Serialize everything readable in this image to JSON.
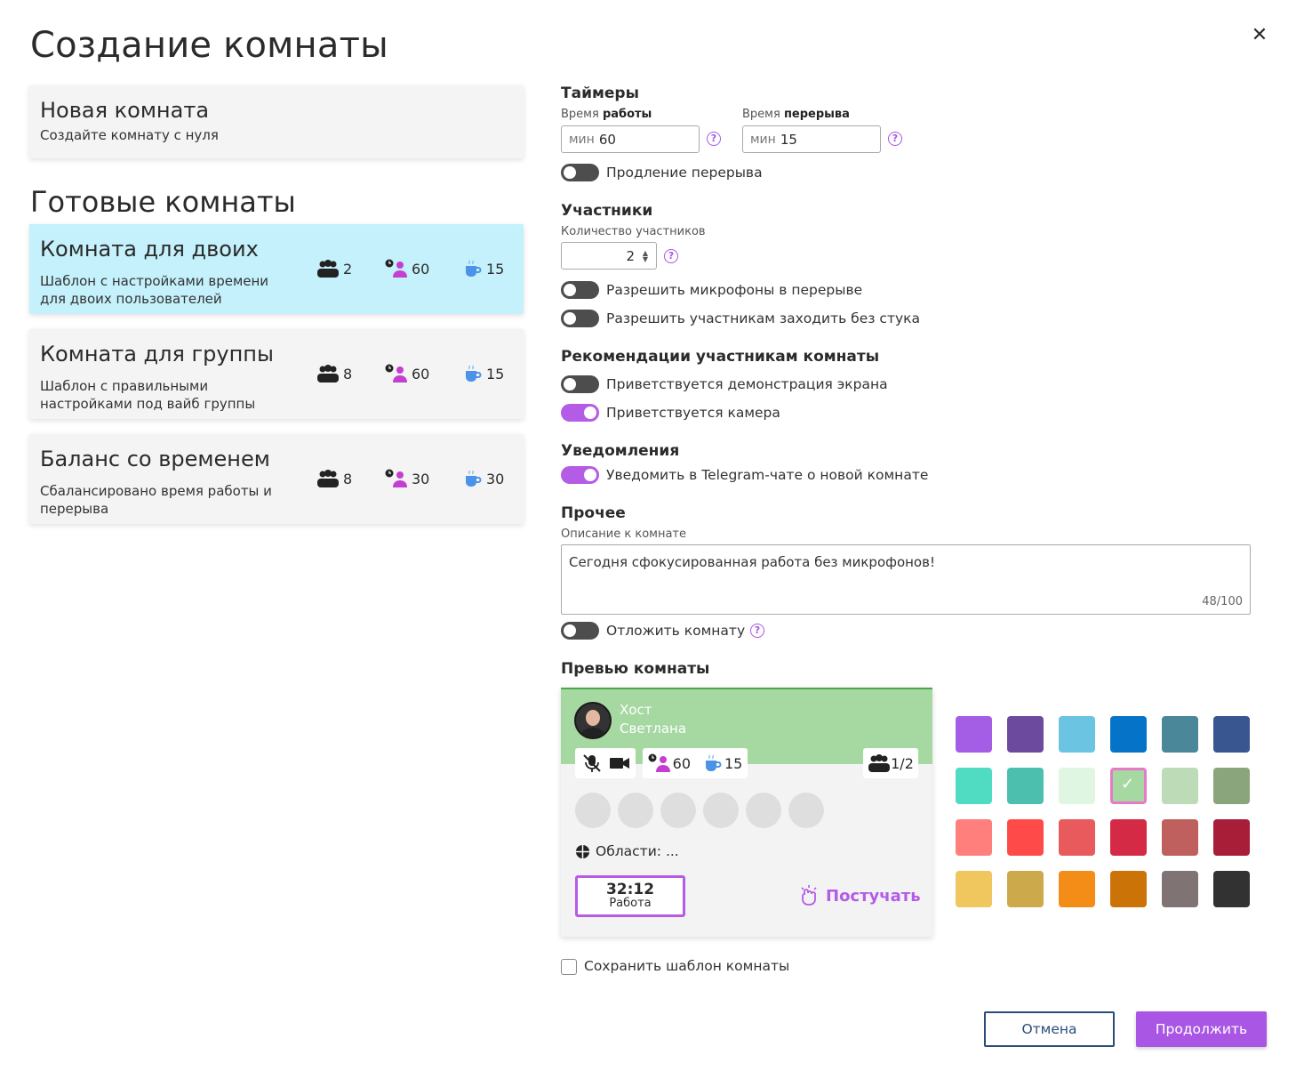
{
  "title": "Создание комнаты",
  "new_room": {
    "title": "Новая комната",
    "subtitle": "Создайте комнату с нуля"
  },
  "ready_title": "Готовые комнаты",
  "templates": [
    {
      "title": "Комната для двоих",
      "subtitle": "Шаблон с настройками времени для двоих пользователей",
      "participants": "2",
      "work": "60",
      "break": "15"
    },
    {
      "title": "Комната для группы",
      "subtitle": "Шаблон с правильными настройками под вайб группы",
      "participants": "8",
      "work": "60",
      "break": "15"
    },
    {
      "title": "Баланс со временем",
      "subtitle": "Сбалансировано время работы и перерыва",
      "participants": "8",
      "work": "30",
      "break": "30"
    }
  ],
  "timers": {
    "title": "Таймеры",
    "work_label_a": "Время ",
    "work_label_b": "работы",
    "work_prefix": "мин",
    "work_value": "60",
    "break_label_a": "Время ",
    "break_label_b": "перерыва",
    "break_prefix": "мин",
    "break_value": "15",
    "extend_label": "Продление перерыва",
    "help": "?"
  },
  "participants": {
    "title": "Участники",
    "count_label": "Количество участников",
    "count": "2",
    "mic_label": "Разрешить микрофоны в перерыве",
    "noknock_label": "Разрешить участникам заходить без стука"
  },
  "recommend": {
    "title": "Рекомендации участникам комнаты",
    "screen_label": "Приветствуется демонстрация экрана",
    "camera_label": "Приветствуется камера"
  },
  "notify": {
    "title": "Уведомления",
    "telegram_label": "Уведомить в Telegram-чате о новой комнате"
  },
  "other": {
    "title": "Прочее",
    "desc_label": "Описание к комнате",
    "desc": "Сегодня сфокусированная работа без микрофонов!",
    "counter": "48/100",
    "postpone_label": "Отложить комнату"
  },
  "preview": {
    "title": "Превью комнаты",
    "host_role": "Хост",
    "host_name": "Светлана",
    "work": "60",
    "break": "15",
    "occupancy": "1/2",
    "areas": "Области: ...",
    "timer_value": "32:12",
    "timer_name": "Работа",
    "knock": "Постучать",
    "header_color": "#a6d9a2",
    "accent": "#b45ce6"
  },
  "swatches": [
    [
      "#a45ee6",
      "#6c4a9e",
      "#6bc4e1",
      "#0574c8",
      "#4a8799",
      "#3a5690"
    ],
    [
      "#4fdcc3",
      "#4dbfae",
      "#dff6e3",
      "#a6d9a2",
      "#bedbb8",
      "#8aa57b"
    ],
    [
      "#ff7f7c",
      "#ff4a4a",
      "#e85a5c",
      "#d42a45",
      "#c0605e",
      "#a81d38"
    ],
    [
      "#f0c65e",
      "#cca94b",
      "#f38d17",
      "#cc7308",
      "#7f7373",
      "#323232"
    ]
  ],
  "save_template_label": "Сохранить шаблон комнаты",
  "buttons": {
    "cancel": "Отмена",
    "continue": "Продолжить"
  }
}
